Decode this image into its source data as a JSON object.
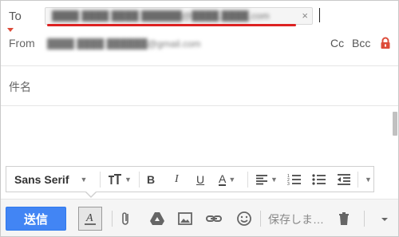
{
  "header": {
    "to_label": "To",
    "recipient_chip": "████ ████ ████ ██████@████.████.com",
    "chip_close": "×",
    "from_label": "From",
    "from_value": "████ ████ ██████@gmail.com",
    "cc_label": "Cc",
    "bcc_label": "Bcc"
  },
  "subject": {
    "label": "件名"
  },
  "format_toolbar": {
    "font_name": "Sans Serif",
    "bold": "B",
    "italic": "I",
    "underline": "U",
    "text_color": "A"
  },
  "actions": {
    "send_label": "送信",
    "saving_text": "保存しま…"
  },
  "colors": {
    "accent": "#4285f4",
    "annotation_red": "#dd2222",
    "lock": "#dd4b39"
  }
}
